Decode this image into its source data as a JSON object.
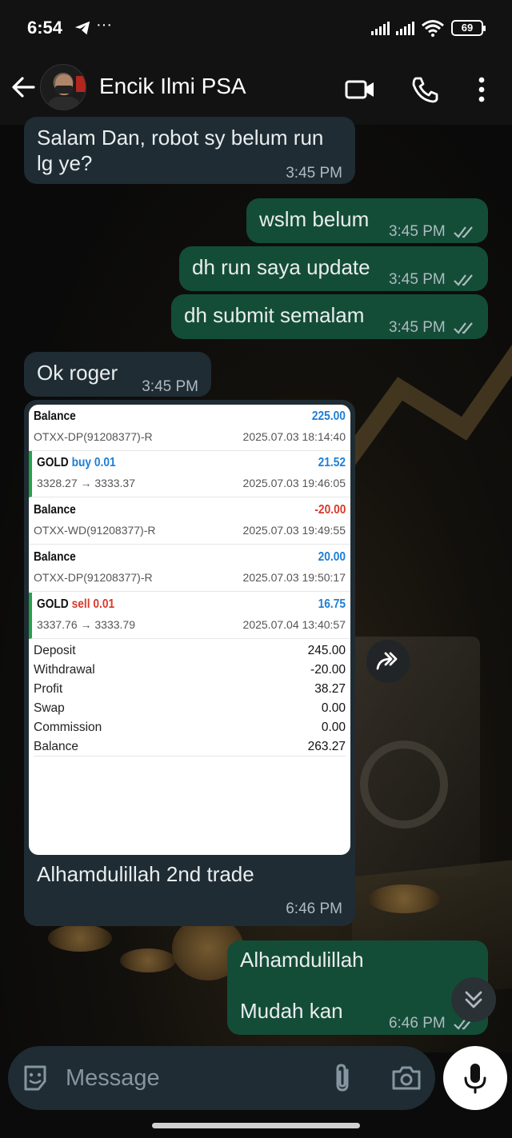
{
  "status_bar": {
    "time": "6:54",
    "battery": "69"
  },
  "header": {
    "contact_name": "Encik Ilmi PSA"
  },
  "messages": [
    {
      "text_line1": "Salam Dan, robot sy belum run",
      "text_line2": "lg ye?",
      "time": "3:45 PM"
    },
    {
      "text": "wslm belum",
      "time": "3:45 PM"
    },
    {
      "text": "dh run saya update",
      "time": "3:45 PM"
    },
    {
      "text": "dh submit semalam",
      "time": "3:45 PM"
    },
    {
      "text": "Ok roger",
      "time": "3:45 PM"
    },
    {
      "caption": "Alhamdulillah 2nd trade",
      "time": "6:46 PM"
    },
    {
      "text_line1": "Alhamdulillah",
      "text_line2": "Mudah kan",
      "time": "6:46 PM"
    }
  ],
  "trade_history": {
    "rows": [
      {
        "title": "Balance",
        "detail": "OTXX-DP(91208377)-R",
        "amount": "225.00",
        "date": "2025.07.03 18:14:40",
        "color": "blue"
      },
      {
        "title": "GOLD",
        "side": "buy 0.01",
        "detail": "3328.27 → 3333.37",
        "amount": "21.52",
        "date": "2025.07.03 19:46:05",
        "color": "blue"
      },
      {
        "title": "Balance",
        "detail": "OTXX-WD(91208377)-R",
        "amount": "-20.00",
        "date": "2025.07.03 19:49:55",
        "color": "red"
      },
      {
        "title": "Balance",
        "detail": "OTXX-DP(91208377)-R",
        "amount": "20.00",
        "date": "2025.07.03 19:50:17",
        "color": "blue"
      },
      {
        "title": "GOLD",
        "side": "sell 0.01",
        "detail": "3337.76 → 3333.79",
        "amount": "16.75",
        "date": "2025.07.04 13:40:57",
        "color": "blue"
      }
    ],
    "summary": [
      {
        "label": "Deposit",
        "value": "245.00"
      },
      {
        "label": "Withdrawal",
        "value": "-20.00"
      },
      {
        "label": "Profit",
        "value": "38.27"
      },
      {
        "label": "Swap",
        "value": "0.00"
      },
      {
        "label": "Commission",
        "value": "0.00"
      },
      {
        "label": "Balance",
        "value": "263.27"
      }
    ]
  },
  "composer": {
    "placeholder": "Message"
  },
  "colors": {
    "incoming": "#1f2c33",
    "outgoing": "#144d37",
    "profit_blue": "#1c7fd6",
    "loss_red": "#d8392b",
    "gold_bar": "#25a24b"
  }
}
